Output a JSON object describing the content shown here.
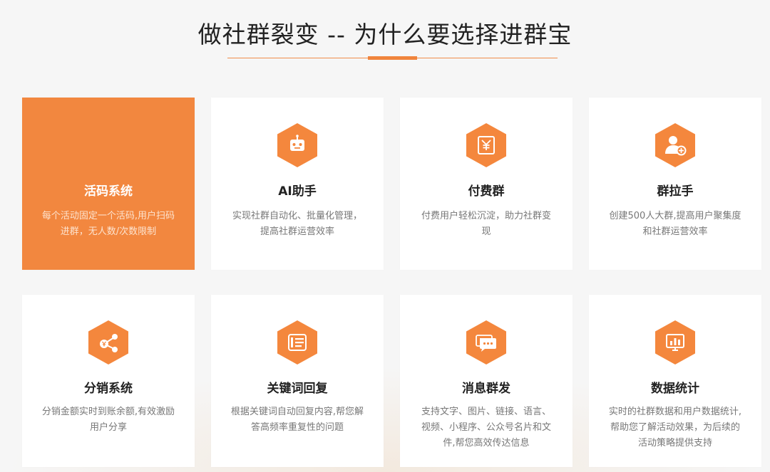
{
  "section": {
    "title": "做社群裂变 -- 为什么要选择进群宝"
  },
  "colors": {
    "accent": "#f2873f",
    "hex_icon": "#f4873d"
  },
  "features": [
    {
      "title": "活码系统",
      "desc": "每个活动固定一个活码,用户扫码进群，无人数/次数限制",
      "icon": "none",
      "active": true
    },
    {
      "title": "AI助手",
      "desc": "实现社群自动化、批量化管理，提高社群运营效率",
      "icon": "robot-icon",
      "active": false
    },
    {
      "title": "付费群",
      "desc": "付费用户轻松沉淀，助力社群变现",
      "icon": "yen-icon",
      "active": false
    },
    {
      "title": "群拉手",
      "desc": "创建500人大群,提高用户聚集度和社群运营效率",
      "icon": "user-add-icon",
      "active": false
    },
    {
      "title": "分销系统",
      "desc": "分销金额实时到账余额,有效激励用户分享",
      "icon": "share-icon",
      "active": false
    },
    {
      "title": "关键词回复",
      "desc": "根据关键词自动回复内容,帮您解答高频率重复性的问题",
      "icon": "keyword-icon",
      "active": false
    },
    {
      "title": "消息群发",
      "desc": "支持文字、图片、链接、语言、视频、小程序、公众号名片和文件,帮您高效传达信息",
      "icon": "message-icon",
      "active": false
    },
    {
      "title": "数据统计",
      "desc": "实时的社群数据和用户数据统计,帮助您了解活动效果，为后续的活动策略提供支持",
      "icon": "chart-icon",
      "active": false
    }
  ]
}
